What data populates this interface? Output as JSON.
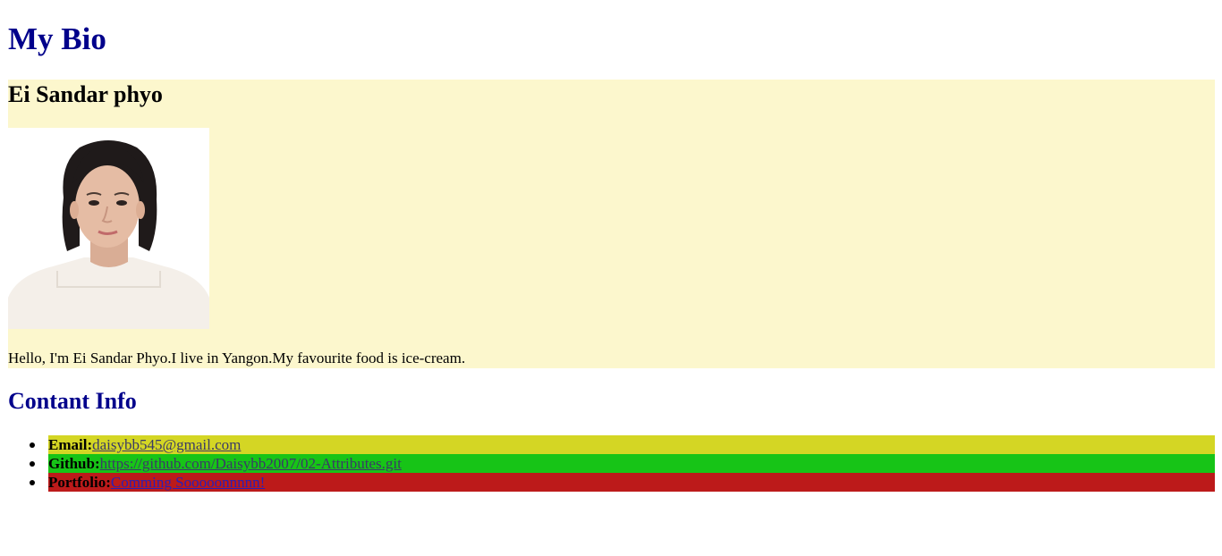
{
  "header": {
    "title": "My Bio"
  },
  "bio": {
    "name": "Ei Sandar phyo",
    "text": "Hello, I'm Ei Sandar Phyo.I live in Yangon.My favourite food is ice-cream.",
    "section_background": "#fcf7cd",
    "photo_icon": "portrait-photo"
  },
  "contact": {
    "title": "Contant Info",
    "items": [
      {
        "label": "Email:",
        "link_text": "daisybb545@gmail.com",
        "background": "#d4d624"
      },
      {
        "label": "Github:",
        "link_text": "https://github.com/Daisybb2007/02-Attributes.git",
        "background": "#17c417"
      },
      {
        "label": "Portfolio:",
        "link_text": "Comming Sooooonnnnn!",
        "background": "#bc1a1a"
      }
    ]
  },
  "colors": {
    "heading": "#00008b"
  }
}
